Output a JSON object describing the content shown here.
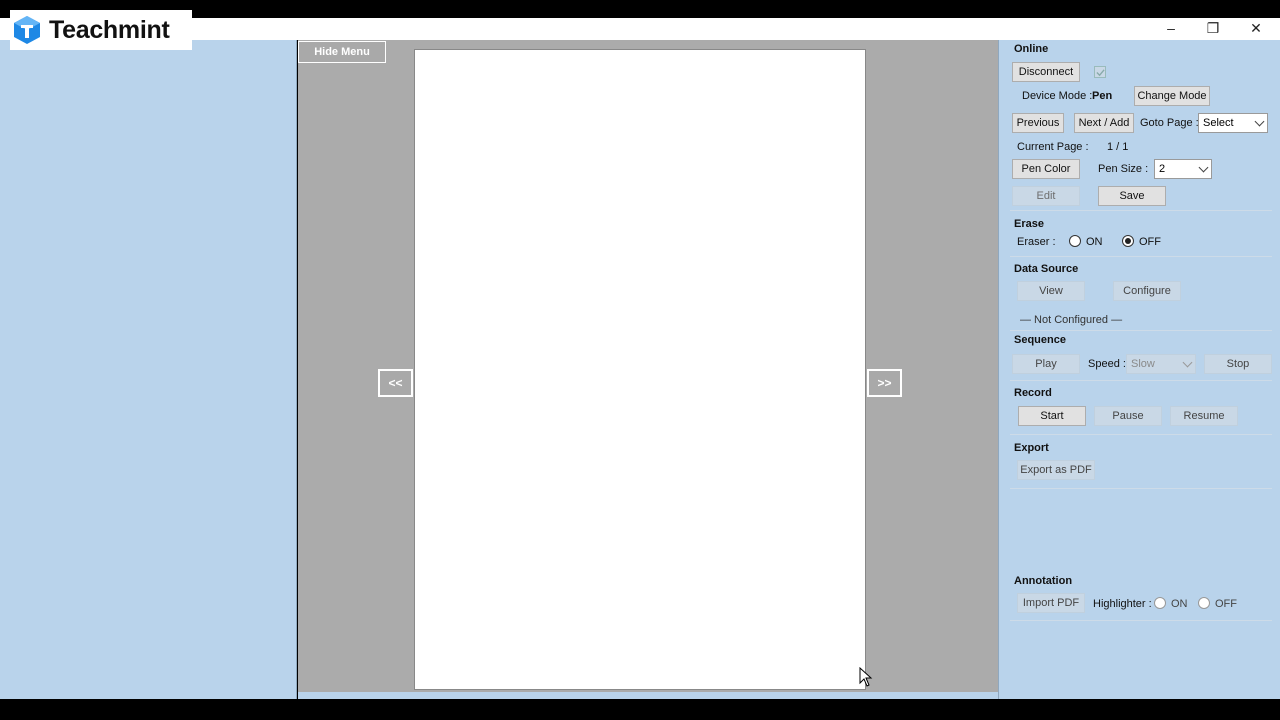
{
  "app": {
    "brand": "Teachmint"
  },
  "left_toolbar": {
    "hide_menu_label": "Hide Menu",
    "prev_arrow": "<<",
    "next_arrow": ">>"
  },
  "window_controls": {
    "minimize": "–",
    "restore": "❐",
    "close": "✕"
  },
  "online": {
    "title": "Online",
    "disconnect_label": "Disconnect",
    "device_mode_label": "Device Mode :",
    "device_mode_value": "Pen",
    "change_mode_label": "Change Mode",
    "previous_label": "Previous",
    "next_add_label": "Next / Add",
    "goto_page_label": "Goto Page :",
    "goto_page_value": "Select",
    "current_page_label": "Current Page :",
    "current_page_value": "1 / 1",
    "pen_color_label": "Pen Color",
    "pen_size_label": "Pen Size :",
    "pen_size_value": "2",
    "edit_label": "Edit",
    "save_label": "Save"
  },
  "erase": {
    "title": "Erase",
    "eraser_label": "Eraser :",
    "on_label": "ON",
    "off_label": "OFF",
    "selected": "OFF"
  },
  "data_source": {
    "title": "Data Source",
    "view_label": "View",
    "configure_label": "Configure",
    "status": "— Not Configured —"
  },
  "sequence": {
    "title": "Sequence",
    "play_label": "Play",
    "speed_label": "Speed :",
    "speed_value": "Slow",
    "stop_label": "Stop"
  },
  "record": {
    "title": "Record",
    "start_label": "Start",
    "pause_label": "Pause",
    "resume_label": "Resume"
  },
  "export": {
    "title": "Export",
    "export_pdf_label": "Export as PDF"
  },
  "annotation": {
    "title": "Annotation",
    "import_pdf_label": "Import PDF",
    "highlighter_label": "Highlighter :",
    "on_label": "ON",
    "off_label": "OFF"
  },
  "colors": {
    "panel_bg": "#b9d3eb",
    "canvas_bg": "#ababab",
    "page_bg": "#ffffff",
    "brand_blue": "#1e88e5"
  }
}
